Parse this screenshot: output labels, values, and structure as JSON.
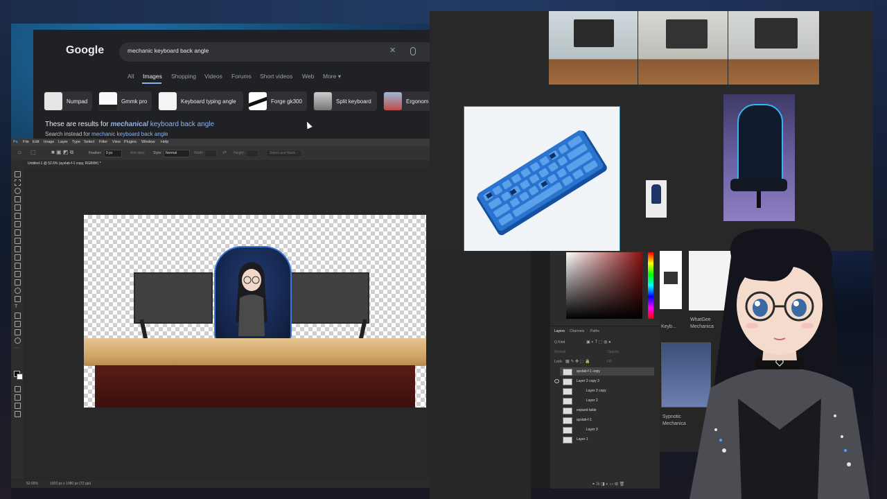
{
  "google": {
    "logo": "Google",
    "query": "mechanic keyboard back angle",
    "clear_glyph": "✕",
    "tabs": [
      "All",
      "Images",
      "Shopping",
      "Videos",
      "Forums",
      "Short videos",
      "Web",
      "More ▾"
    ],
    "chips": [
      "Numpad",
      "Gmmk pro",
      "Keyboard typing angle",
      "Forge gk300",
      "Split keyboard",
      "Ergonom"
    ],
    "results_prefix": "These are results for ",
    "results_em": "mechanical",
    "results_rest": " keyboard back angle",
    "instead_prefix": "Search instead for ",
    "instead_link": "mechanic keyboard back angle"
  },
  "photoshop": {
    "menus": [
      "Ps",
      "File",
      "Edit",
      "Image",
      "Layer",
      "Type",
      "Select",
      "Filter",
      "View",
      "Plugins",
      "Window",
      "Help"
    ],
    "options": {
      "feather_label": "Feather:",
      "feather_value": "0 px",
      "anti_alias": "Anti-alias",
      "style_label": "Style:",
      "style_value": "Normal",
      "width_label": "Width:",
      "height_label": "Height:",
      "select_mask": "Select and Mask..."
    },
    "doc_tab": "Untitled-1 @ 52.6% (ayslab-f-1 copy, RGB/8#) *",
    "zoom": "52.65%",
    "doc_size": "1920 px x 1080 px (72 ppi)",
    "layer_tabs": [
      "Layers",
      "Channels",
      "Paths"
    ],
    "layer_kind": "Q Kind",
    "blend_mode": "Normal",
    "opacity_label": "Opacity:",
    "lock_label": "Lock:",
    "fill_label": "Fill:",
    "layers": [
      "ayslab-f-1 copy",
      "Layer 2 copy 3",
      "Layer 2 copy",
      "Layer 2",
      "expand table",
      "ayslab-f-1",
      "Layer 3",
      "Layer 1"
    ]
  },
  "right_column": {
    "label1": "Keyb...",
    "label2a": "WhatGee",
    "label2b": "Mechanica",
    "label3a": "Sypnotic",
    "label3b": "Mechanica"
  },
  "colors": {
    "google_bg": "#202124",
    "google_link": "#8ab4f8",
    "ps_bg": "#282828",
    "chair_accent": "#3a78d8",
    "keyboard_blue": "#1f66c6"
  }
}
